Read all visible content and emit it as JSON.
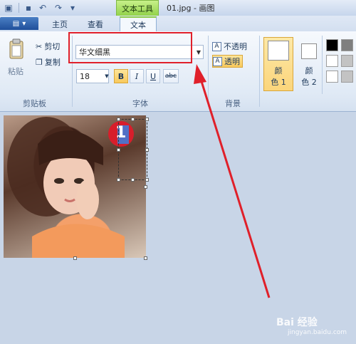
{
  "window": {
    "context_tab_label": "文本工具",
    "doc_title": "01.jpg - 画图"
  },
  "tabs": [
    {
      "label": "主页"
    },
    {
      "label": "查看"
    },
    {
      "label": "文本"
    }
  ],
  "clipboard": {
    "paste_label": "粘贴",
    "cut_label": "剪切",
    "copy_label": "复制",
    "group_label": "剪贴板"
  },
  "font": {
    "family_value": "华文细黑",
    "size_value": "18",
    "bold_label": "B",
    "italic_label": "I",
    "underline_label": "U",
    "strike_label": "abc",
    "group_label": "字体"
  },
  "background": {
    "opaque_label": "不透明",
    "transparent_label": "透明",
    "group_label": "背景"
  },
  "colors": {
    "color1_line1": "颜",
    "color1_line2": "色 1",
    "color2_line1": "颜",
    "color2_line2": "色 2",
    "palette": [
      "#000000",
      "#7f7f7f",
      "#ffffff",
      "#c3c3c3",
      "#ffffff",
      "#c3c3c3"
    ]
  },
  "canvas": {
    "text_entered": "1"
  },
  "watermark": {
    "brand": "Bai  经验",
    "url": "jingyan.baidu.com"
  },
  "annotation_colors": {
    "highlight": "#e0202a"
  }
}
